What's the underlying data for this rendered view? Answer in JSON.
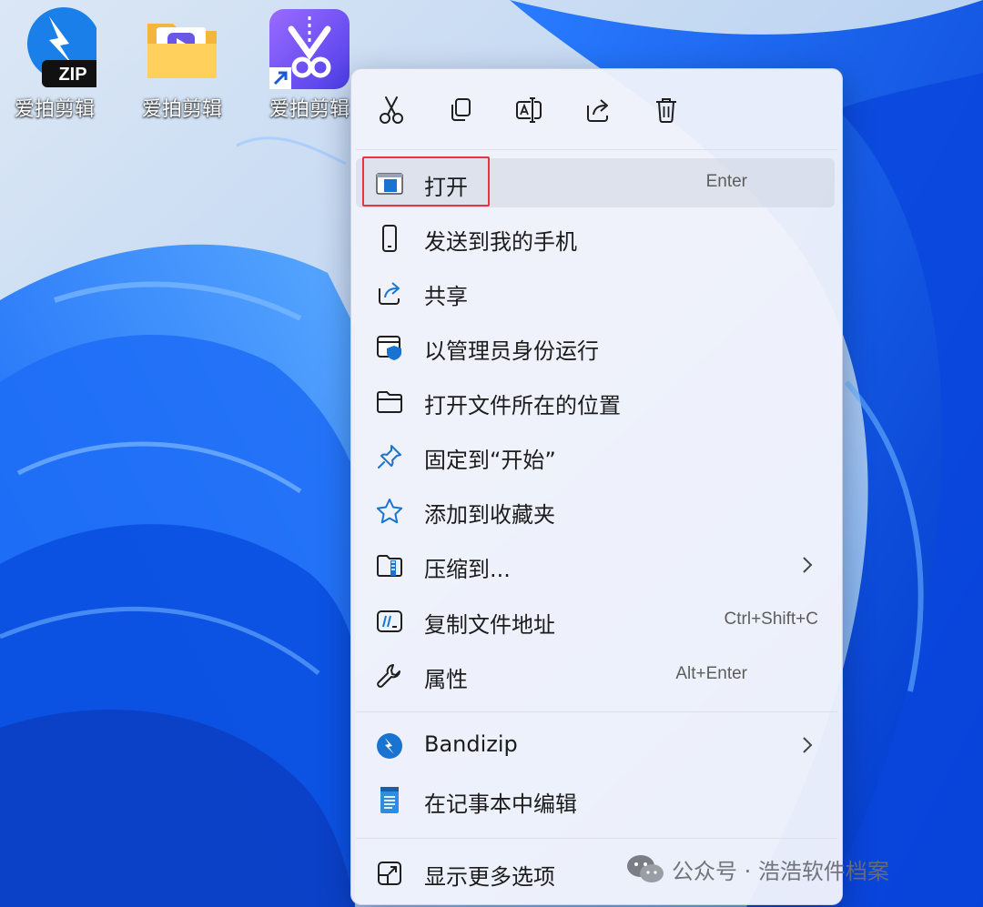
{
  "desktop": {
    "icons": [
      {
        "label": "爱拍剪辑",
        "badge": "ZIP",
        "icon": "bandizip-archive-icon"
      },
      {
        "label": "爱拍剪辑",
        "icon": "folder-icon"
      },
      {
        "label": "爱拍剪辑",
        "icon": "aipai-shortcut-icon"
      }
    ]
  },
  "context_menu": {
    "toolbar": [
      {
        "name": "cut",
        "icon": "scissors-icon"
      },
      {
        "name": "copy",
        "icon": "copy-icon"
      },
      {
        "name": "rename",
        "icon": "rename-icon"
      },
      {
        "name": "share",
        "icon": "share-icon"
      },
      {
        "name": "delete",
        "icon": "trash-icon"
      }
    ],
    "items": [
      {
        "label": "打开",
        "shortcut": "Enter",
        "icon": "app-window-icon",
        "highlighted": true
      },
      {
        "label": "发送到我的手机",
        "icon": "phone-icon"
      },
      {
        "label": "共享",
        "icon": "share-icon"
      },
      {
        "label": "以管理员身份运行",
        "icon": "admin-shield-icon"
      },
      {
        "label": "打开文件所在的位置",
        "icon": "folder-outline-icon"
      },
      {
        "label": "固定到“开始”",
        "icon": "pin-icon"
      },
      {
        "label": "添加到收藏夹",
        "icon": "star-icon"
      },
      {
        "label": "压缩到...",
        "icon": "zip-folder-icon",
        "has_submenu": true
      },
      {
        "label": "复制文件地址",
        "shortcut": "Ctrl+Shift+C",
        "icon": "path-copy-icon"
      },
      {
        "label": "属性",
        "shortcut": "Alt+Enter",
        "icon": "wrench-icon"
      }
    ],
    "extra_items": [
      {
        "label": "Bandizip",
        "icon": "bandizip-icon",
        "has_submenu": true
      },
      {
        "label": "在记事本中编辑",
        "icon": "notepad-icon"
      }
    ],
    "footer_items": [
      {
        "label": "显示更多选项",
        "icon": "more-options-icon"
      }
    ]
  },
  "watermark": {
    "text": "公众号 · 浩浩软件档案",
    "icon": "wechat-icon"
  },
  "colors": {
    "accent": "#0067c0",
    "highlight_box": "#e8343c",
    "menu_bg": "#f0f3fb"
  }
}
